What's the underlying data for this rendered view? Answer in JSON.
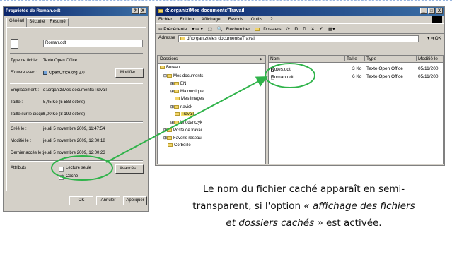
{
  "dialog": {
    "title": "Propriétés de Roman.odt",
    "title_buttons": [
      "?",
      "X"
    ],
    "tabs": [
      "Général",
      "Sécurité",
      "Résumé"
    ],
    "filename": "Roman.odt",
    "rows": [
      {
        "label": "Type de fichier :",
        "value": "Texte Open Office"
      },
      {
        "label": "S'ouvre avec :",
        "value": "OpenOffice.org 2.0"
      },
      {
        "label": "Emplacement :",
        "value": "d:\\organiz\\Mes documents\\Travail"
      },
      {
        "label": "Taille :",
        "value": "5,45 Ko (5 583 octets)"
      },
      {
        "label": "Taille sur le disque :",
        "value": "8,00 Ko (8 192 octets)"
      },
      {
        "label": "Créé le :",
        "value": "jeudi 5 novembre 2009, 11:47:54"
      },
      {
        "label": "Modifié le :",
        "value": "jeudi 5 novembre 2009, 12:00:18"
      },
      {
        "label": "Dernier accès le :",
        "value": "jeudi 5 novembre 2009, 12:00:23"
      }
    ],
    "modify_button": "Modifier...",
    "attributes_label": "Attributs :",
    "readonly_label": "Lecture seule",
    "readonly_checked": false,
    "hidden_label": "Caché",
    "hidden_checked": true,
    "advanced_button": "Avancés...",
    "ok_button": "OK",
    "cancel_button": "Annuler",
    "apply_button": "Appliquer"
  },
  "explorer": {
    "title": "d:\\organiz\\Mes documents\\Travail",
    "window_buttons": [
      "_",
      "□",
      "X"
    ],
    "menu": [
      "Fichier",
      "Edition",
      "Affichage",
      "Favoris",
      "Outils",
      "?"
    ],
    "toolbar": {
      "back": "⇦ Précédente",
      "search": "Rechercher",
      "folders": "Dossiers"
    },
    "address_label": "Adresse",
    "address_value": "d:\\organiz\\Mes documents\\Travail",
    "go_label": "OK",
    "tree_header": "Dossiers",
    "tree": [
      {
        "label": "Bureau",
        "level": 0,
        "selected": false
      },
      {
        "label": "Mes documents",
        "level": 1,
        "selected": false
      },
      {
        "label": "EN",
        "level": 2,
        "selected": false
      },
      {
        "label": "Ma musique",
        "level": 2,
        "selected": false
      },
      {
        "label": "Mes images",
        "level": 2,
        "selected": false
      },
      {
        "label": "navick",
        "level": 2,
        "selected": false
      },
      {
        "label": "Travail",
        "level": 2,
        "selected": true
      },
      {
        "label": "Wlodarczyk",
        "level": 2,
        "selected": false
      },
      {
        "label": "Poste de travail",
        "level": 1,
        "selected": false
      },
      {
        "label": "Favoris réseau",
        "level": 1,
        "selected": false
      },
      {
        "label": "Corbeille",
        "level": 1,
        "selected": false
      }
    ],
    "columns": [
      "Nom",
      "Taille",
      "Type",
      "Modifié le"
    ],
    "files": [
      {
        "name": "Notes.odt",
        "size": "3 Ko",
        "type": "Texte Open Office",
        "modified": "05/11/200",
        "hidden": false
      },
      {
        "name": "Roman.odt",
        "size": "6 Ko",
        "type": "Texte Open Office",
        "modified": "05/11/200",
        "hidden": true
      }
    ]
  },
  "caption": {
    "line1": "Le nom du fichier caché apparaît en semi-",
    "line2_plain": "transparent,  si l'option ",
    "line2_em": "« affichage des fichiers",
    "line3_em": "et dossiers cachés »",
    "line3_plain": " est activée."
  },
  "colors": {
    "highlight_circle": "#2fb34a",
    "title_bar": "#0a246a",
    "dialog_bg": "#d4d0c8"
  }
}
